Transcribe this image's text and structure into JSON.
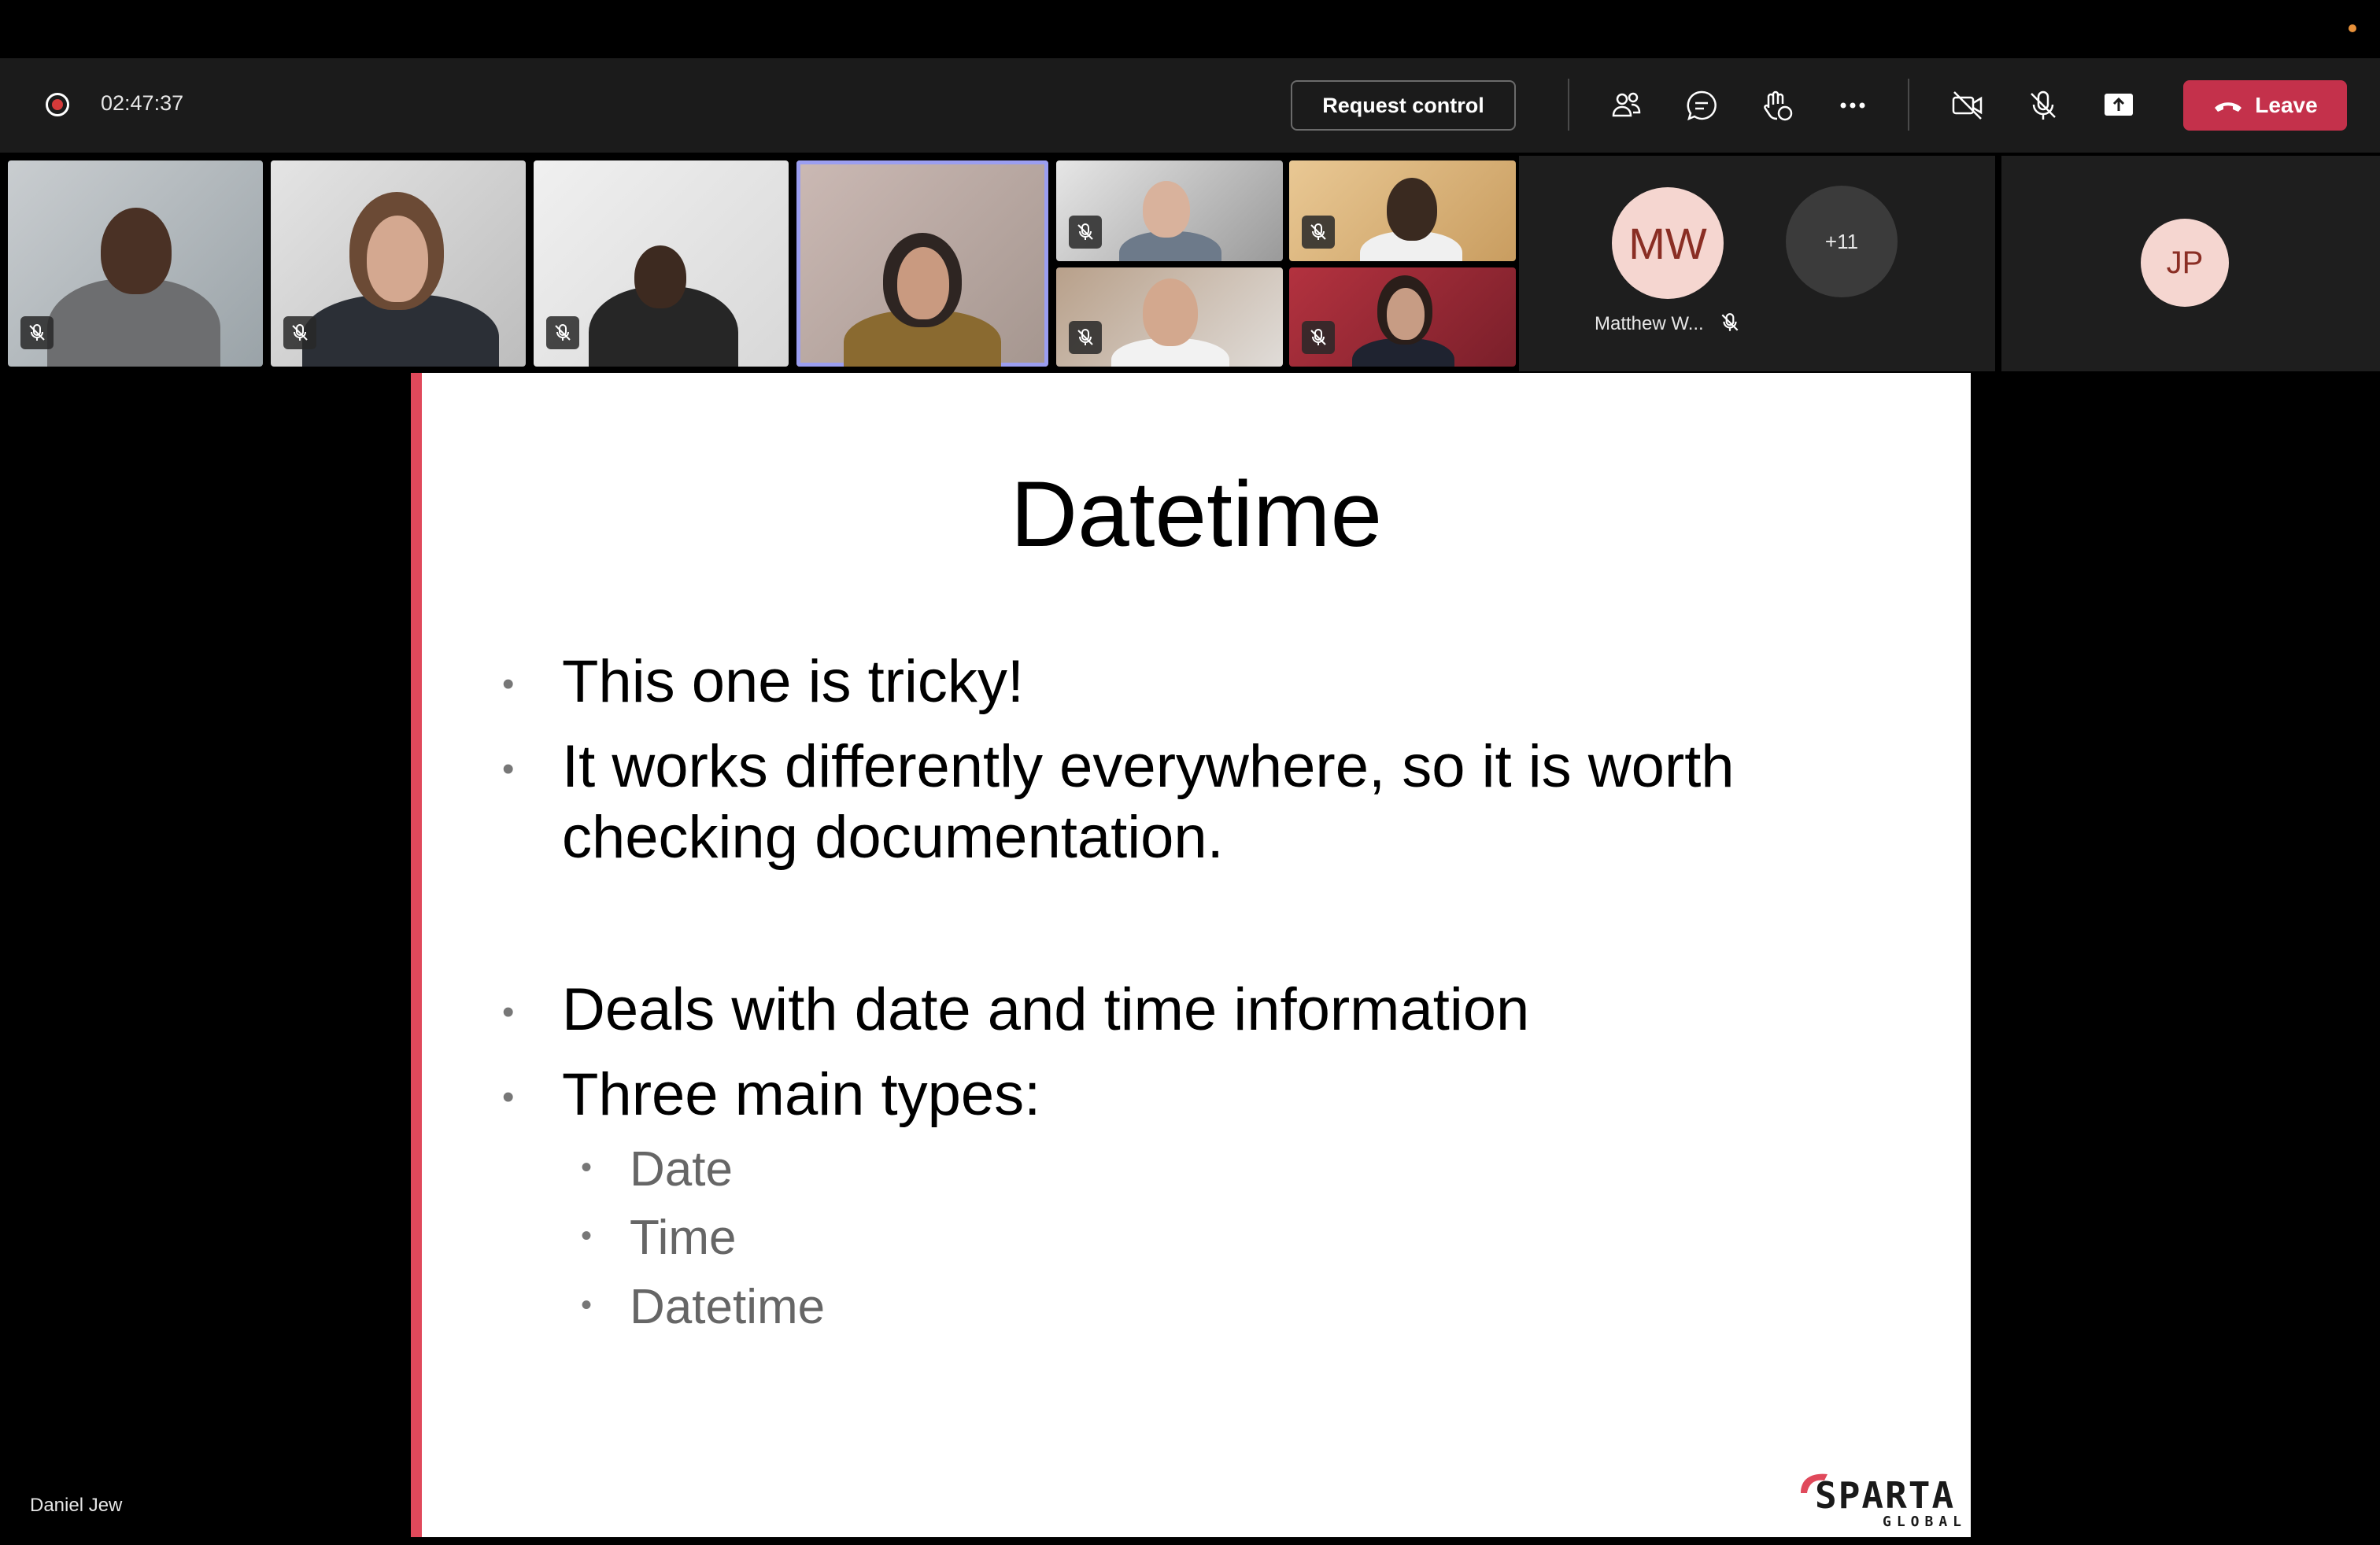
{
  "meeting": {
    "timer": "02:47:37"
  },
  "toolbar": {
    "request_control_label": "Request control",
    "leave_label": "Leave",
    "icons": [
      "participants-icon",
      "chat-icon",
      "reactions-icon",
      "more-icon",
      "camera-off-icon",
      "mic-off-icon",
      "share-icon"
    ]
  },
  "participants": {
    "mw_initials": "MW",
    "mw_name": "Matthew W...",
    "overflow_count": "+11",
    "jp_initials": "JP"
  },
  "slide": {
    "title": "Datetime",
    "bullets": [
      "This one is tricky!",
      "It works differently everywhere, so it is worth",
      "checking documentation.",
      "Deals with date and time information",
      "Three main types:"
    ],
    "sub_bullets": [
      "Date",
      "Time",
      "Datetime"
    ],
    "logo_word": "SPARTA",
    "logo_sub": "GLOBAL"
  },
  "presenter": {
    "name": "Daniel Jew"
  },
  "colors": {
    "leave": "#c4314b",
    "accent_bar": "#e0495b",
    "active_tile": "#9b9ef0"
  }
}
